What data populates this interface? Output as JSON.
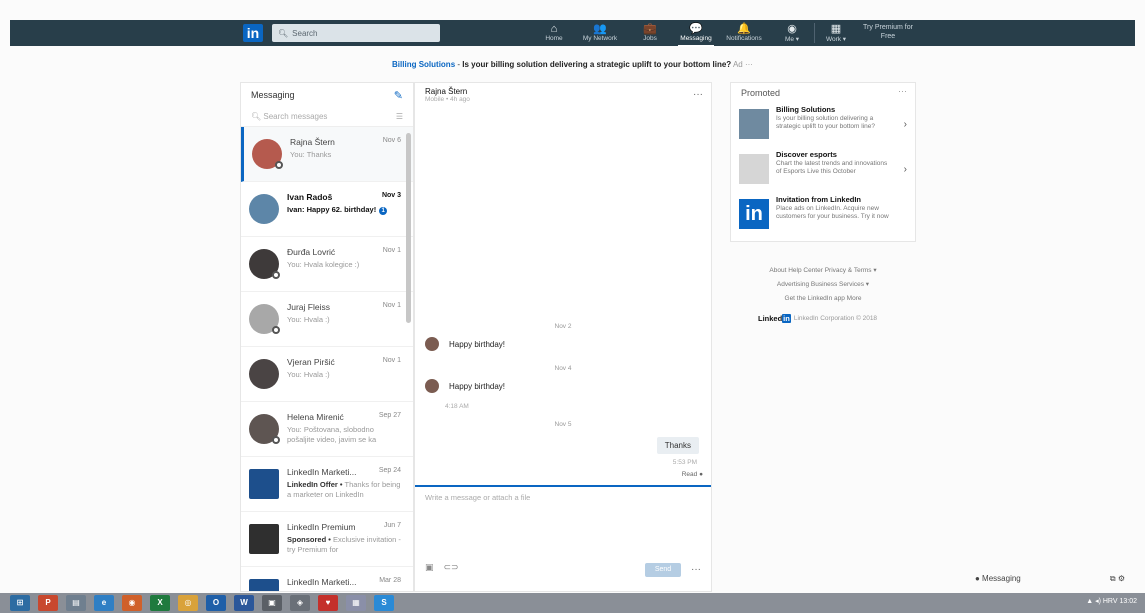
{
  "topbar": {
    "logo": "in",
    "search_placeholder": "Search",
    "nav": [
      {
        "label": "Home",
        "icon": "⌂"
      },
      {
        "label": "My Network",
        "icon": "👥"
      },
      {
        "label": "Jobs",
        "icon": "💼"
      },
      {
        "label": "Messaging",
        "icon": "💬"
      },
      {
        "label": "Notifications",
        "icon": "🔔"
      },
      {
        "label": "Me ▾",
        "icon": "◉"
      },
      {
        "label": "Work ▾",
        "icon": "▦"
      }
    ],
    "premium": "Try Premium for Free"
  },
  "ad_banner": {
    "brand": "Billing Solutions",
    "message": "Is your billing solution delivering a strategic uplift to your bottom line?",
    "tag": "Ad ···"
  },
  "messaging": {
    "title": "Messaging",
    "search_placeholder": "Search messages",
    "conversations": [
      {
        "name": "Rajna Štern",
        "date": "Nov 6",
        "snippet": "You: Thanks"
      },
      {
        "name": "Ivan Radoš",
        "date": "Nov 3",
        "snippet": "Ivan: Happy 62. birthday!"
      },
      {
        "name": "Đurđa Lovrić",
        "date": "Nov 1",
        "snippet": "You: Hvala kolegice :)"
      },
      {
        "name": "Juraj Fleiss",
        "date": "Nov 1",
        "snippet": "You: Hvala :)"
      },
      {
        "name": "Vjeran Piršić",
        "date": "Nov 1",
        "snippet": "You: Hvala :)"
      },
      {
        "name": "Helena Mirenić",
        "date": "Sep 27",
        "snippet": "You: Poštovana, slobodno pošaljite video, javim se ka"
      },
      {
        "name": "LinkedIn Marketi...",
        "date": "Sep 24",
        "snippet_bold": "LinkedIn Offer •",
        "snippet": "Thanks for being a marketer on LinkedIn"
      },
      {
        "name": "LinkedIn Premium",
        "date": "Jun 7",
        "snippet_bold": "Sponsored •",
        "snippet": "Exclusive invitation - try Premium for"
      },
      {
        "name": "LinkedIn Marketi...",
        "date": "Mar 28",
        "snippet": ""
      }
    ]
  },
  "chat": {
    "name": "Rajna Štern",
    "status": "Mobile • 4h ago",
    "date1": "Nov 2",
    "msg1": "Happy birthday!",
    "date2": "Nov 4",
    "msg2": "Happy birthday!",
    "time2": "4:18 AM",
    "date3": "Nov 5",
    "my_msg": "Thanks",
    "my_time": "5:53 PM",
    "read": "Read",
    "compose_placeholder": "Write a message or attach a file",
    "send": "Send"
  },
  "promoted": {
    "title": "Promoted",
    "items": [
      {
        "title": "Billing Solutions",
        "desc": "Is your billing solution delivering a strategic uplift to your bottom line?"
      },
      {
        "title": "Discover esports",
        "desc": "Chart the latest trends and innovations of Esports Live this October"
      },
      {
        "title": "Invitation from LinkedIn",
        "desc": "Place ads on LinkedIn. Acquire new customers for your business. Try it now"
      }
    ]
  },
  "footer": {
    "line1": "About     Help Center     Privacy & Terms ▾",
    "line2": "Advertising     Business Services ▾",
    "line3": "Get the LinkedIn app     More",
    "brand": "Linked",
    "brand_in": "in",
    "copyright": "LinkedIn Corporation © 2018"
  },
  "mini_messaging": {
    "label": "● Messaging",
    "icons": "⧉ ⚙"
  },
  "taskbar": {
    "apps": [
      "⊞",
      "P",
      "▤",
      "e",
      "◉",
      "X",
      "◎",
      "O",
      "W",
      "▣",
      "◈",
      "♥",
      "▦",
      "S"
    ],
    "tray": "▲ ◂) HRV 13:02"
  }
}
